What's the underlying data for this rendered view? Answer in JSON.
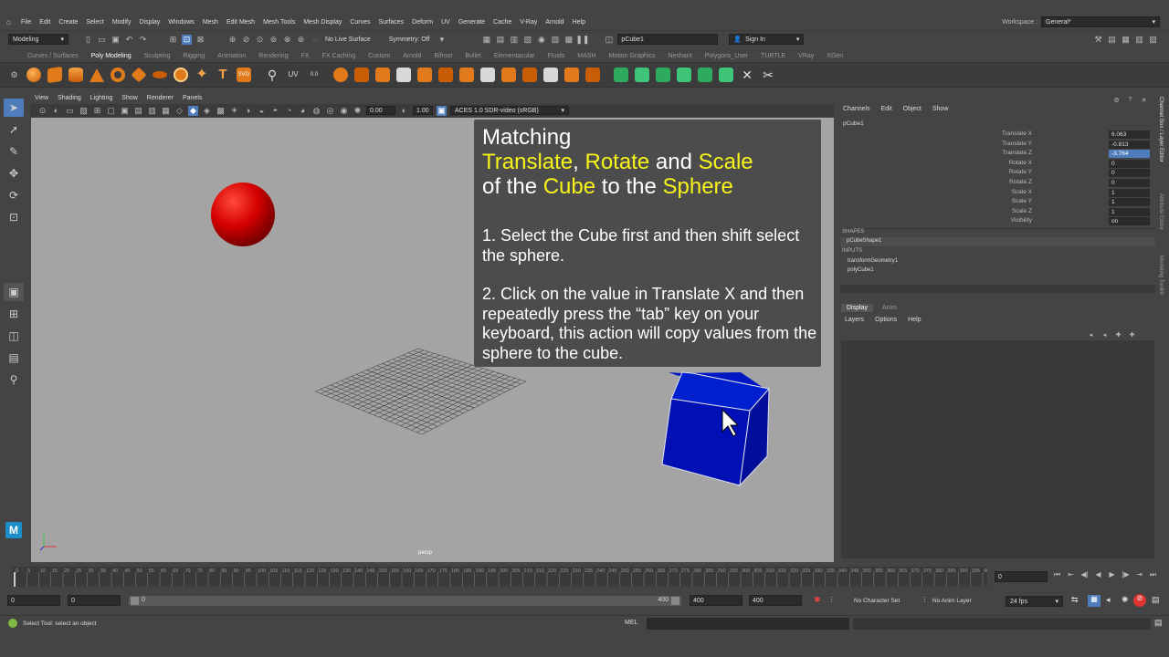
{
  "menubar": {
    "items": [
      "File",
      "Edit",
      "Create",
      "Select",
      "Modify",
      "Display",
      "Windows",
      "Mesh",
      "Edit Mesh",
      "Mesh Tools",
      "Mesh Display",
      "Curves",
      "Surfaces",
      "Deform",
      "UV",
      "Generate",
      "Cache",
      "V-Ray",
      "Arnold",
      "Help"
    ],
    "workspace_label": "Workspace :",
    "workspace_value": "General*"
  },
  "statusline": {
    "mode": "Modeling",
    "live_surface": "No Live Surface",
    "symmetry": "Symmetry: Off",
    "object_field": "pCube1",
    "sign_in": "Sign In"
  },
  "shelf_tabs": [
    "Curves / Surfaces",
    "Poly Modeling",
    "Sculpting",
    "Rigging",
    "Animation",
    "Rendering",
    "FX",
    "FX Caching",
    "Custom",
    "Arnold",
    "Bifrost",
    "Bullet",
    "Elementacular",
    "Fluids",
    "MASH",
    "Motion Graphics",
    "Neshant",
    "Polygons_User",
    "TURTLE",
    "VRay",
    "XGen"
  ],
  "shelf_active": "Poly Modeling",
  "viewport": {
    "menus": [
      "View",
      "Shading",
      "Lighting",
      "Show",
      "Renderer",
      "Panels"
    ],
    "exposure": "0.00",
    "gamma": "1.00",
    "colorspace": "ACES 1.0 SDR-video (sRGB)",
    "camera": "persp"
  },
  "instruction": {
    "title_line1": "Matching",
    "word_translate": "Translate",
    "sep1": ", ",
    "word_rotate": "Rotate",
    "and": " and ",
    "word_scale": "Scale",
    "of_the": "of the ",
    "word_cube": "Cube",
    "to_the": " to the ",
    "word_sphere": "Sphere",
    "step1": "1. Select the Cube first and then shift select the sphere.",
    "step2": "2. Click on the value in Translate X and then repeatedly press the “tab” key on your keyboard, this action will copy values from the sphere to the cube."
  },
  "channelbox": {
    "menus": [
      "Channels",
      "Edit",
      "Object",
      "Show"
    ],
    "object": "pCube1",
    "attributes": [
      {
        "label": "Translate X",
        "value": "6.063"
      },
      {
        "label": "Translate Y",
        "value": "-0.813"
      },
      {
        "label": "Translate Z",
        "value": "-3.764"
      },
      {
        "label": "Rotate X",
        "value": "0"
      },
      {
        "label": "Rotate Y",
        "value": "0"
      },
      {
        "label": "Rotate Z",
        "value": "0"
      },
      {
        "label": "Scale X",
        "value": "1"
      },
      {
        "label": "Scale Y",
        "value": "1"
      },
      {
        "label": "Scale Z",
        "value": "1"
      },
      {
        "label": "Visibility",
        "value": "on"
      }
    ],
    "shapes_header": "SHAPES",
    "shape": "pCubeShape1",
    "inputs_header": "INPUTS",
    "inputs": [
      "transformGeometry1",
      "polyCube1"
    ]
  },
  "side_tabs": [
    "Channel Box / Layer Editor",
    "Attribute Editor",
    "Modeling Toolkit"
  ],
  "layereditor": {
    "tabs": [
      "Display",
      "Anim"
    ],
    "menus": [
      "Layers",
      "Options",
      "Help"
    ]
  },
  "timeline": {
    "ticks": [
      "0",
      "5",
      "10",
      "15",
      "20",
      "25",
      "30",
      "35",
      "40",
      "45",
      "50",
      "55",
      "60",
      "65",
      "70",
      "75",
      "80",
      "85",
      "90",
      "95",
      "100",
      "105",
      "110",
      "115",
      "120",
      "125",
      "130",
      "135",
      "140",
      "145",
      "150",
      "155",
      "160",
      "165",
      "170",
      "175",
      "180",
      "185",
      "190",
      "195",
      "200",
      "205",
      "210",
      "215",
      "220",
      "225",
      "230",
      "235",
      "240",
      "245",
      "250",
      "255",
      "260",
      "265",
      "270",
      "275",
      "280",
      "285",
      "290",
      "295",
      "300",
      "305",
      "310",
      "315",
      "320",
      "325",
      "330",
      "335",
      "340",
      "345",
      "350",
      "355",
      "360",
      "365",
      "370",
      "375",
      "380",
      "385",
      "390",
      "395",
      "40"
    ],
    "current_frame": "0"
  },
  "range": {
    "start": "0",
    "playback_start": "0",
    "slider_start": "0",
    "slider_end": "400",
    "playback_end": "400",
    "end": "400",
    "character_set": "No Character Set",
    "anim_layer": "No Anim Layer",
    "fps": "24 fps"
  },
  "helpline": {
    "text": "Select Tool: select an object",
    "mel_label": "MEL"
  },
  "colors": {
    "highlight": "#f7f41a",
    "sphere": "#d40000",
    "cube": "#0010b4",
    "selection": "#4f7dbb"
  }
}
